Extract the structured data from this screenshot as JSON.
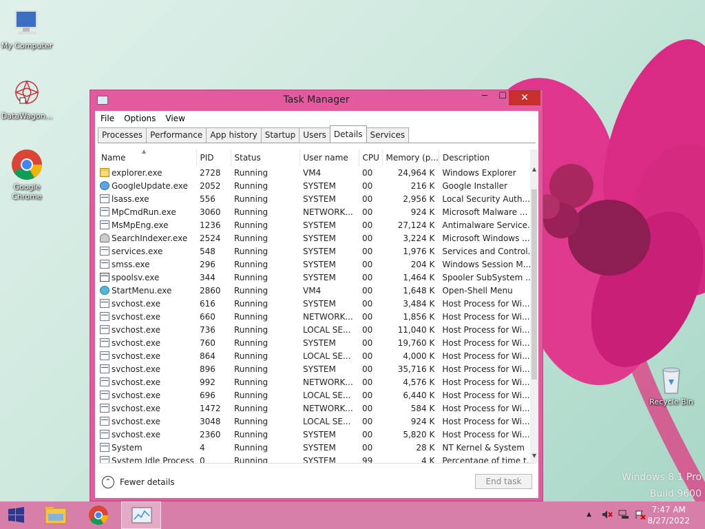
{
  "desktop": {
    "icons": [
      {
        "label": "My Computer"
      },
      {
        "label": "DataWagon..."
      },
      {
        "label": "Google\nChrome"
      },
      {
        "label": "Recycle Bin"
      }
    ],
    "watermark": {
      "line1": "Windows 8.1 Pro",
      "line2": "Build 9600"
    }
  },
  "window": {
    "title": "Task Manager",
    "controls": {
      "minimize": "─",
      "maximize": "☐",
      "close": "✕"
    },
    "menu": [
      "File",
      "Options",
      "View"
    ],
    "tabs": [
      "Processes",
      "Performance",
      "App history",
      "Startup",
      "Users",
      "Details",
      "Services"
    ],
    "active_tab": "Details",
    "columns": [
      "Name",
      "PID",
      "Status",
      "User name",
      "CPU",
      "Memory (p...",
      "Description"
    ],
    "rows": [
      {
        "icon": "folder",
        "name": "explorer.exe",
        "pid": "2728",
        "status": "Running",
        "user": "VM4",
        "cpu": "00",
        "mem": "24,964 K",
        "desc": "Windows Explorer"
      },
      {
        "icon": "globe",
        "name": "GoogleUpdate.exe",
        "pid": "2052",
        "status": "Running",
        "user": "SYSTEM",
        "cpu": "00",
        "mem": "216 K",
        "desc": "Google Installer"
      },
      {
        "icon": "window",
        "name": "lsass.exe",
        "pid": "556",
        "status": "Running",
        "user": "SYSTEM",
        "cpu": "00",
        "mem": "2,956 K",
        "desc": "Local Security Auth..."
      },
      {
        "icon": "window",
        "name": "MpCmdRun.exe",
        "pid": "3060",
        "status": "Running",
        "user": "NETWORK...",
        "cpu": "00",
        "mem": "924 K",
        "desc": "Microsoft Malware ..."
      },
      {
        "icon": "window",
        "name": "MsMpEng.exe",
        "pid": "1236",
        "status": "Running",
        "user": "SYSTEM",
        "cpu": "00",
        "mem": "27,124 K",
        "desc": "Antimalware Service..."
      },
      {
        "icon": "person",
        "name": "SearchIndexer.exe",
        "pid": "2524",
        "status": "Running",
        "user": "SYSTEM",
        "cpu": "00",
        "mem": "3,224 K",
        "desc": "Microsoft Windows ..."
      },
      {
        "icon": "window",
        "name": "services.exe",
        "pid": "548",
        "status": "Running",
        "user": "SYSTEM",
        "cpu": "00",
        "mem": "1,976 K",
        "desc": "Services and Control..."
      },
      {
        "icon": "window",
        "name": "smss.exe",
        "pid": "296",
        "status": "Running",
        "user": "SYSTEM",
        "cpu": "00",
        "mem": "204 K",
        "desc": "Windows Session M..."
      },
      {
        "icon": "printer",
        "name": "spoolsv.exe",
        "pid": "344",
        "status": "Running",
        "user": "SYSTEM",
        "cpu": "00",
        "mem": "1,464 K",
        "desc": "Spooler SubSystem ..."
      },
      {
        "icon": "ball",
        "name": "StartMenu.exe",
        "pid": "2860",
        "status": "Running",
        "user": "VM4",
        "cpu": "00",
        "mem": "1,648 K",
        "desc": "Open-Shell Menu"
      },
      {
        "icon": "window",
        "name": "svchost.exe",
        "pid": "616",
        "status": "Running",
        "user": "SYSTEM",
        "cpu": "00",
        "mem": "3,484 K",
        "desc": "Host Process for Wi..."
      },
      {
        "icon": "window",
        "name": "svchost.exe",
        "pid": "660",
        "status": "Running",
        "user": "NETWORK...",
        "cpu": "00",
        "mem": "1,856 K",
        "desc": "Host Process for Wi..."
      },
      {
        "icon": "window",
        "name": "svchost.exe",
        "pid": "736",
        "status": "Running",
        "user": "LOCAL SE...",
        "cpu": "00",
        "mem": "11,040 K",
        "desc": "Host Process for Wi..."
      },
      {
        "icon": "window",
        "name": "svchost.exe",
        "pid": "760",
        "status": "Running",
        "user": "SYSTEM",
        "cpu": "00",
        "mem": "19,760 K",
        "desc": "Host Process for Wi..."
      },
      {
        "icon": "window",
        "name": "svchost.exe",
        "pid": "864",
        "status": "Running",
        "user": "LOCAL SE...",
        "cpu": "00",
        "mem": "4,000 K",
        "desc": "Host Process for Wi..."
      },
      {
        "icon": "window",
        "name": "svchost.exe",
        "pid": "896",
        "status": "Running",
        "user": "SYSTEM",
        "cpu": "00",
        "mem": "35,716 K",
        "desc": "Host Process for Wi..."
      },
      {
        "icon": "window",
        "name": "svchost.exe",
        "pid": "992",
        "status": "Running",
        "user": "NETWORK...",
        "cpu": "00",
        "mem": "4,576 K",
        "desc": "Host Process for Wi..."
      },
      {
        "icon": "window",
        "name": "svchost.exe",
        "pid": "696",
        "status": "Running",
        "user": "LOCAL SE...",
        "cpu": "00",
        "mem": "6,440 K",
        "desc": "Host Process for Wi..."
      },
      {
        "icon": "window",
        "name": "svchost.exe",
        "pid": "1472",
        "status": "Running",
        "user": "NETWORK...",
        "cpu": "00",
        "mem": "584 K",
        "desc": "Host Process for Wi..."
      },
      {
        "icon": "window",
        "name": "svchost.exe",
        "pid": "3048",
        "status": "Running",
        "user": "LOCAL SE...",
        "cpu": "00",
        "mem": "924 K",
        "desc": "Host Process for Wi..."
      },
      {
        "icon": "window",
        "name": "svchost.exe",
        "pid": "2360",
        "status": "Running",
        "user": "SYSTEM",
        "cpu": "00",
        "mem": "5,820 K",
        "desc": "Host Process for Wi..."
      },
      {
        "icon": "window",
        "name": "System",
        "pid": "4",
        "status": "Running",
        "user": "SYSTEM",
        "cpu": "00",
        "mem": "28 K",
        "desc": "NT Kernel & System"
      },
      {
        "icon": "window",
        "name": "System Idle Process",
        "pid": "0",
        "status": "Running",
        "user": "SYSTEM",
        "cpu": "99",
        "mem": "4 K",
        "desc": "Percentage of time t..."
      }
    ],
    "footer": {
      "fewer_details": "Fewer details",
      "end_task": "End task"
    }
  },
  "taskbar": {
    "clock_time": "7:47 AM",
    "clock_date": "8/27/2022"
  },
  "colors": {
    "accent": "#e35a9e",
    "taskbar": "#d77fa8",
    "close": "#c7302c"
  }
}
